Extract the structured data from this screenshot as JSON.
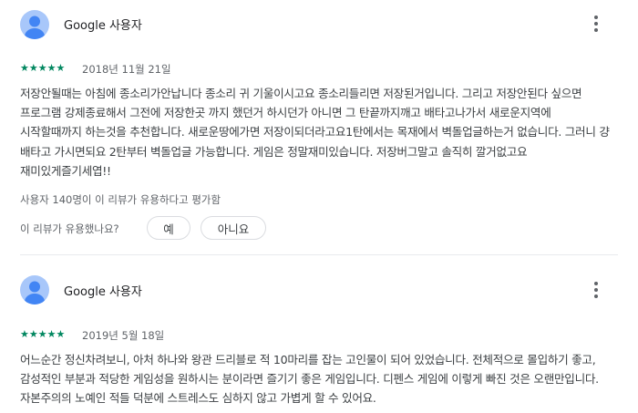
{
  "reviews": [
    {
      "author": "Google 사용자",
      "stars": "★★★★★",
      "date": "2018년 11월 21일",
      "text": "저장안될때는 아침에 종소리가안납니다 종소리 귀 기울이시고요 종소리들리면 저장된거입니다. 그리고 저장안된다 싶으면 프로그램 강제종료해서 그전에 저장한곳 까지 했던거 하시던가 아니면 그 탄끝까지깨고 배타고나가서 새로운지역에 시작할때까지 하는것을 추천합니다. 새로운땅에가면 저장이되더라고요1탄에서는 목재에서 벽돌업글하는거 없습니다. 그러니 걍 배타고 가시면되요 2탄부터 벽돌업글 가능합니다. 게임은 정말재미있습니다. 저장버그말고 솔직히 깔거없고요 재미있게즐기세엽!!",
      "helpful_count": "사용자 140명이 이 리뷰가 유용하다고 평가함",
      "helpful_question": "이 리뷰가 유용했나요?",
      "yes_label": "예",
      "no_label": "아니요"
    },
    {
      "author": "Google 사용자",
      "stars": "★★★★★",
      "date": "2019년 5월 18일",
      "text": "어느순간 정신차려보니, 아처 하나와 왕관 드리블로 적 10마리를 잡는 고인물이 되어 있었습니다. 전체적으로 몰입하기 좋고, 감성적인 부분과 적당한 게임성을 원하시는 분이라면 즐기기 좋은 게임입니다. 디펜스 게임에 이렇게 빠진 것은 오랜만입니다. 자본주의의 노예인 적들 덕분에 스트레스도 심하지 않고 가볍게 할 수 있어요."
    }
  ],
  "colors": {
    "star": "#01875f",
    "avatar": "#a8c7fa",
    "avatar_figure": "#4285f4"
  },
  "icons": {
    "avatar": "person-avatar-icon",
    "menu": "more-vert-icon"
  }
}
